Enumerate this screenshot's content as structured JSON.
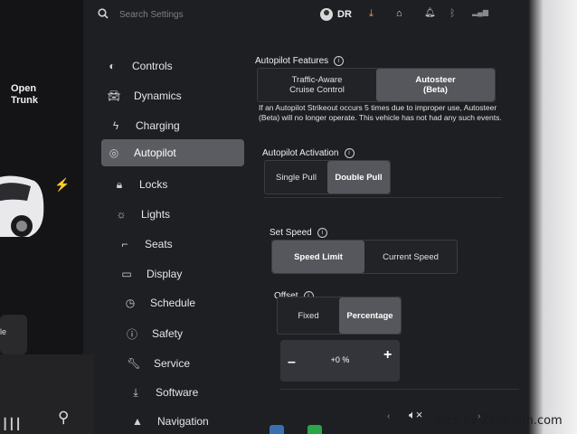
{
  "topbar": {
    "search_placeholder": "Search Settings",
    "user_initials": "DR",
    "icons": [
      "search-icon",
      "user-icon",
      "download-icon",
      "garage-icon",
      "bell-icon",
      "bluetooth-icon",
      "lte-signal-icon"
    ],
    "colors": {
      "download": "#e8a23a"
    }
  },
  "car_panel": {
    "open_trunk": "Open\nTrunk",
    "card_text": "le"
  },
  "sidebar": {
    "items": [
      {
        "label": "Controls",
        "icon": "toggle-icon"
      },
      {
        "label": "Dynamics",
        "icon": "car-icon"
      },
      {
        "label": "Charging",
        "icon": "bolt-icon"
      },
      {
        "label": "Autopilot",
        "icon": "steering-wheel-icon",
        "active": true
      },
      {
        "label": "Locks",
        "icon": "lock-icon"
      },
      {
        "label": "Lights",
        "icon": "sun-icon"
      },
      {
        "label": "Seats",
        "icon": "seat-icon"
      },
      {
        "label": "Display",
        "icon": "display-icon"
      },
      {
        "label": "Schedule",
        "icon": "clock-icon"
      },
      {
        "label": "Safety",
        "icon": "alert-icon"
      },
      {
        "label": "Service",
        "icon": "wrench-icon"
      },
      {
        "label": "Software",
        "icon": "download-icon"
      },
      {
        "label": "Navigation",
        "icon": "navigation-icon"
      }
    ]
  },
  "autopilot_features": {
    "label": "Autopilot Features",
    "options": [
      "Traffic-Aware\nCruise Control",
      "Autosteer\n(Beta)"
    ],
    "selected": "Autosteer\n(Beta)",
    "strikeout_notice": "If an Autopilot Strikeout occurs 5 times due to improper use, Autosteer (Beta) will no longer operate. This vehicle has not had any such events."
  },
  "autopilot_activation": {
    "label": "Autopilot Activation",
    "options": [
      "Single Pull",
      "Double Pull"
    ],
    "selected": "Double Pull"
  },
  "set_speed": {
    "label": "Set Speed",
    "options": [
      "Speed Limit",
      "Current Speed"
    ],
    "selected": "Speed Limit"
  },
  "offset": {
    "label": "Offset",
    "options": [
      "Fixed",
      "Percentage"
    ],
    "selected": "Percentage",
    "value": "+0 %",
    "minus": "–",
    "plus": "+"
  },
  "dock": {
    "mute_icon": "volume-mute-icon",
    "app_colors": [
      "#3a6fb0",
      "#2aa54a"
    ]
  },
  "watermark": "pics by Zennonn.com"
}
